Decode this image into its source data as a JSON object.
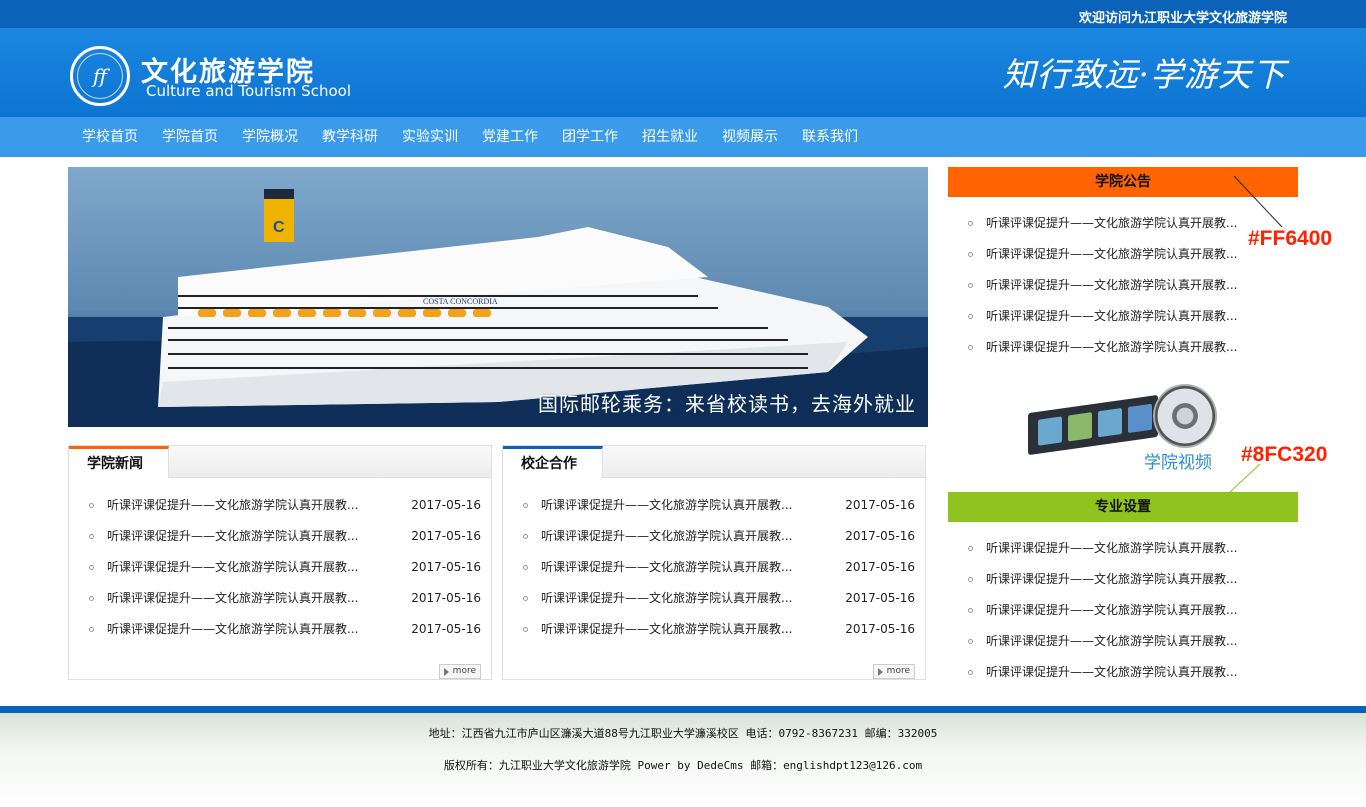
{
  "topbar": {
    "welcome": "欢迎访问九江职业大学文化旅游学院"
  },
  "header": {
    "logo_cn": "文化旅游学院",
    "logo_en": "Culture and Tourism School",
    "slogan": "知行致远·学游天下"
  },
  "nav": {
    "items": [
      "学校首页",
      "学院首页",
      "学院概况",
      "教学科研",
      "实验实训",
      "党建工作",
      "团学工作",
      "招生就业",
      "视频展示",
      "联系我们"
    ]
  },
  "banner": {
    "caption": "国际邮轮乘务：来省校读书，去海外就业",
    "ship_name": "COSTA CONCORDIA"
  },
  "news": {
    "title": "学院新闻",
    "items": [
      {
        "title": "听课评课促提升——文化旅游学院认真开展教...",
        "date": "2017-05-16"
      },
      {
        "title": "听课评课促提升——文化旅游学院认真开展教...",
        "date": "2017-05-16"
      },
      {
        "title": "听课评课促提升——文化旅游学院认真开展教...",
        "date": "2017-05-16"
      },
      {
        "title": "听课评课促提升——文化旅游学院认真开展教...",
        "date": "2017-05-16"
      },
      {
        "title": "听课评课促提升——文化旅游学院认真开展教...",
        "date": "2017-05-16"
      }
    ],
    "more": "more"
  },
  "coop": {
    "title": "校企合作",
    "items": [
      {
        "title": "听课评课促提升——文化旅游学院认真开展教...",
        "date": "2017-05-16"
      },
      {
        "title": "听课评课促提升——文化旅游学院认真开展教...",
        "date": "2017-05-16"
      },
      {
        "title": "听课评课促提升——文化旅游学院认真开展教...",
        "date": "2017-05-16"
      },
      {
        "title": "听课评课促提升——文化旅游学院认真开展教...",
        "date": "2017-05-16"
      },
      {
        "title": "听课评课促提升——文化旅游学院认真开展教...",
        "date": "2017-05-16"
      }
    ],
    "more": "more"
  },
  "notice": {
    "title": "学院公告",
    "color": "#FF6400",
    "annotation": "#FF6400",
    "items": [
      "听课评课促提升——文化旅游学院认真开展教...",
      "听课评课促提升——文化旅游学院认真开展教...",
      "听课评课促提升——文化旅游学院认真开展教...",
      "听课评课促提升——文化旅游学院认真开展教...",
      "听课评课促提升——文化旅游学院认真开展教..."
    ]
  },
  "video": {
    "label": "学院视频"
  },
  "majors": {
    "title": "专业设置",
    "color": "#8FC320",
    "annotation": "#8FC320",
    "items": [
      "听课评课促提升——文化旅游学院认真开展教...",
      "听课评课促提升——文化旅游学院认真开展教...",
      "听课评课促提升——文化旅游学院认真开展教...",
      "听课评课促提升——文化旅游学院认真开展教...",
      "听课评课促提升——文化旅游学院认真开展教..."
    ]
  },
  "footer": {
    "address": "地址：江西省九江市庐山区濂溪大道88号九江职业大学濂溪校区 电话：0792-8367231 邮编：332005",
    "copyright": "版权所有：九江职业大学文化旅游学院 Power by DedeCms 邮箱：englishdpt123@126.com"
  },
  "colors": {
    "primary_blue": "#0a63b8",
    "nav_blue": "#3a9bea"
  }
}
